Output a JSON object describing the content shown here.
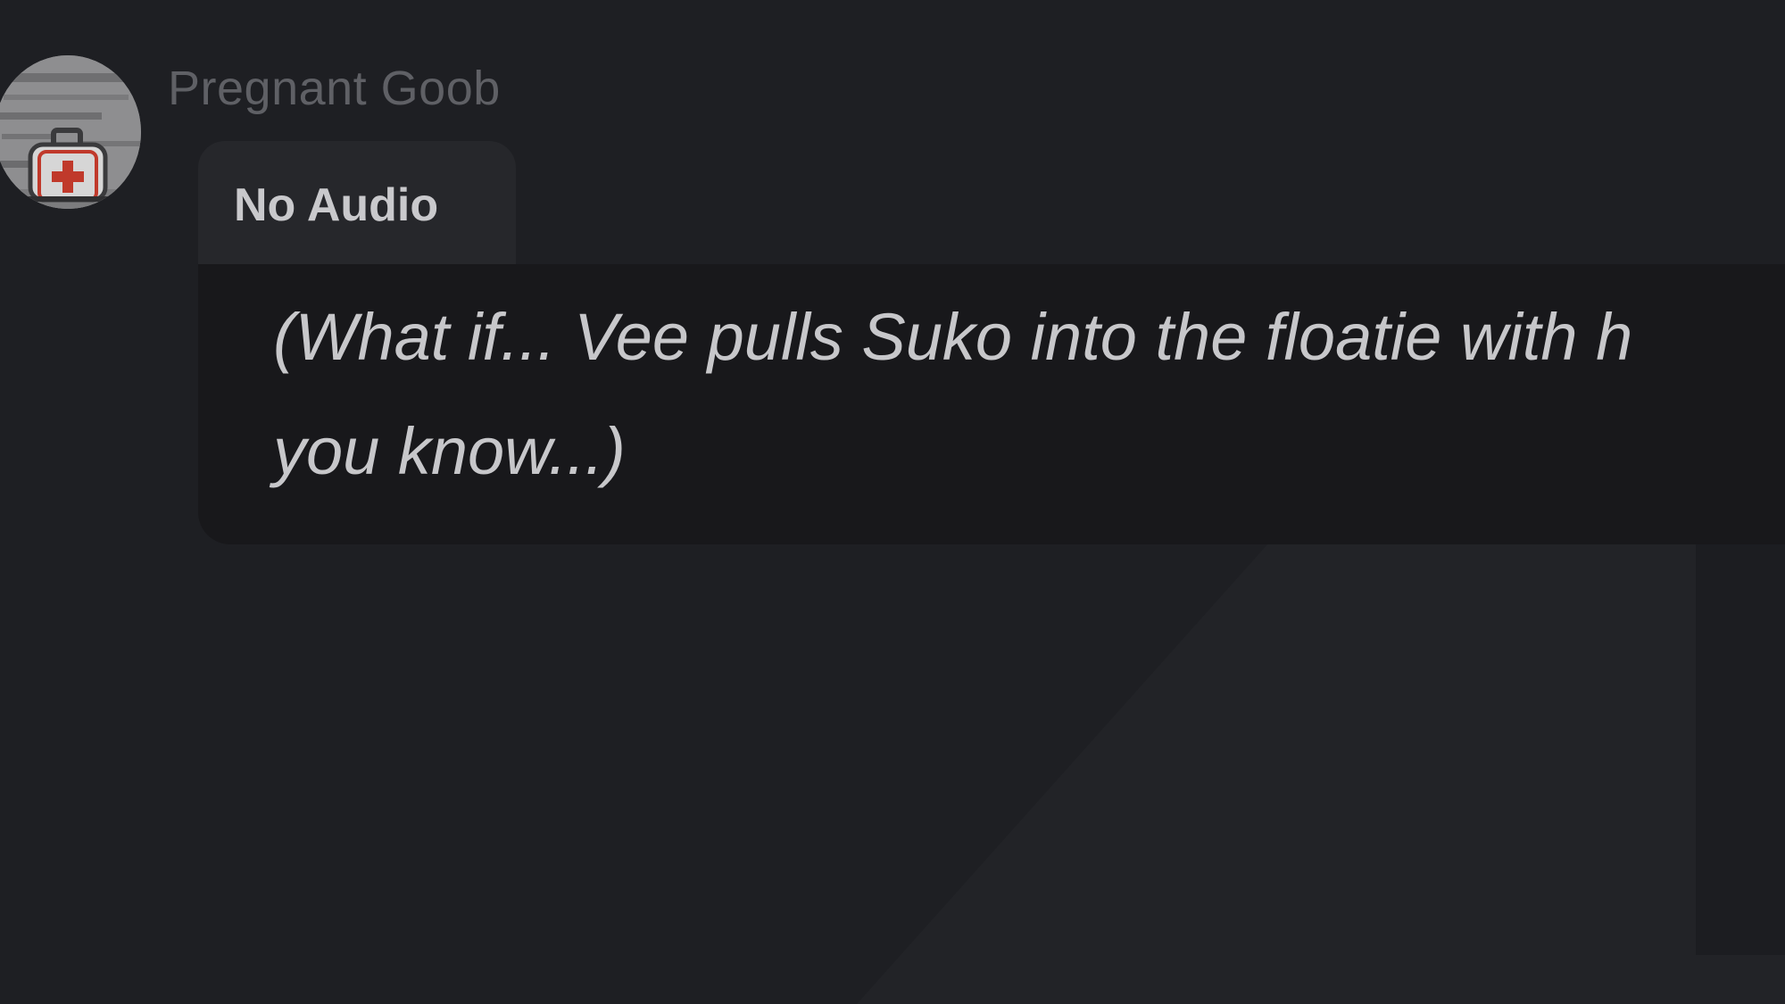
{
  "message": {
    "author": "Pregnant Goob",
    "avatar_icon": "medical-kit-icon",
    "header_label": "No Audio",
    "text_line1": "(What if... Vee pulls Suko into the floatie with h",
    "text_line2": "you know...)"
  },
  "colors": {
    "background": "#1e1f23",
    "bubble_body": "#18181b",
    "bubble_header": "#26272b",
    "author_text": "#5f6065",
    "message_text": "#c7c7ca",
    "accent_red": "#c0392b"
  }
}
